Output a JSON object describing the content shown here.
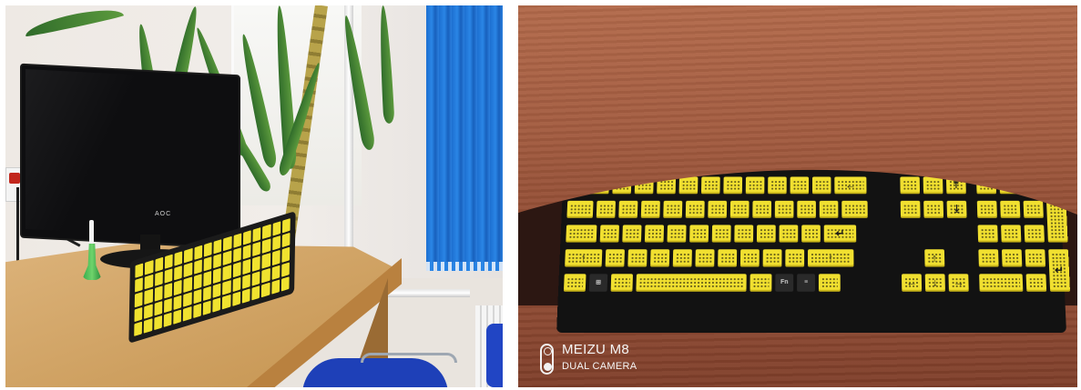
{
  "left_photo": {
    "monitor_brand": "AOC"
  },
  "right_photo": {
    "watermark": {
      "brand": "MEIZU M8",
      "subtitle": "DUAL CAMERA",
      "icon": "dual-camera-icon"
    },
    "keyboard": {
      "key_color": "#f1e030",
      "body_color": "#121212",
      "fn_label": "Fn"
    }
  },
  "colors": {
    "curtain": "#2a86e6",
    "desk": "#d5a35e",
    "wood": "#a35c40",
    "watermark_text": "#f5f5f5"
  }
}
